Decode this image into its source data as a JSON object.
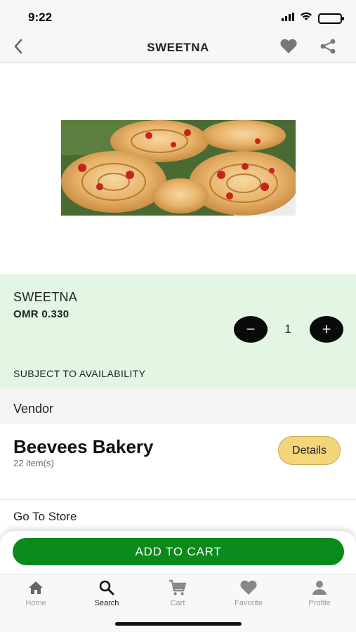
{
  "status_bar": {
    "time": "9:22",
    "battery_level": 1.0
  },
  "nav": {
    "title": "SWEETNA",
    "back_icon": "chevron-left-icon",
    "favorite_icon": "heart-icon",
    "share_icon": "share-icon"
  },
  "product": {
    "image_icon": "pastry-photo",
    "name": "SWEETNA",
    "price": "OMR 0.330",
    "quantity": "1",
    "minus_label": "−",
    "plus_label": "+",
    "availability": "SUBJECT TO AVAILABILITY"
  },
  "vendor": {
    "header": "Vendor",
    "name": "Beevees Bakery",
    "items": "22 item(s)",
    "details_label": "Details",
    "go_to_store": "Go To Store"
  },
  "cart": {
    "add_label": "ADD TO CART",
    "button_color": "#0a8a1a"
  },
  "tabs": [
    {
      "label": "Home",
      "icon": "home-icon",
      "active": false
    },
    {
      "label": "Search",
      "icon": "search-icon",
      "active": true
    },
    {
      "label": "Cart",
      "icon": "cart-icon",
      "active": false
    },
    {
      "label": "Favorite",
      "icon": "heart-icon",
      "active": false
    },
    {
      "label": "Profile",
      "icon": "person-icon",
      "active": false
    }
  ],
  "colors": {
    "info_panel": "#e3f5e3",
    "details_button": "#f3d57a",
    "accent": "#0a8a1a"
  }
}
